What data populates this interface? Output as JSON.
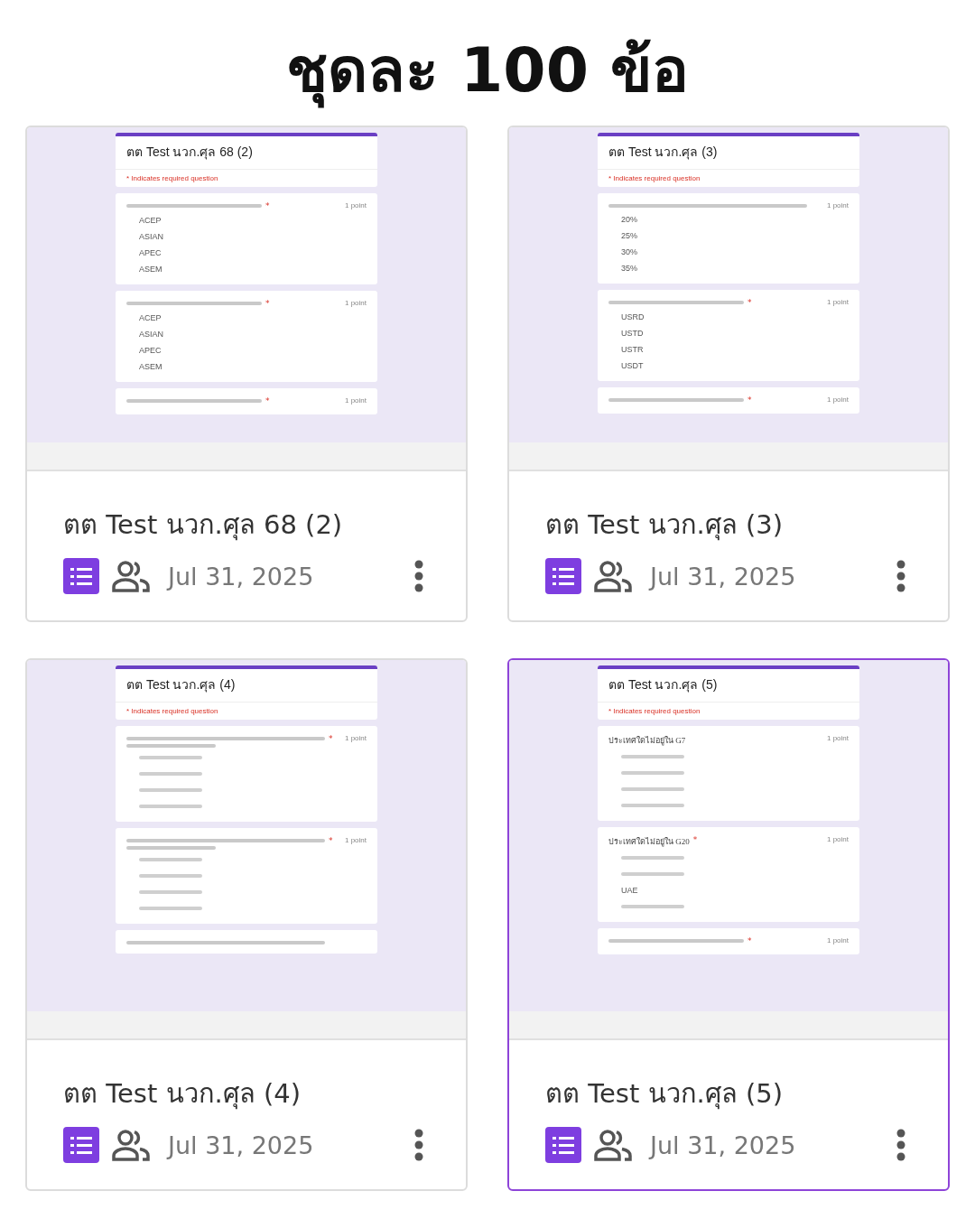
{
  "heading": "ชุดละ 100 ข้อ",
  "cards": [
    {
      "selected": false,
      "title": "ตต Test นวก.ศุล 68 (2)",
      "date": "Jul 31, 2025",
      "form": {
        "title": "ตต Test นวก.ศุล 68 (2)",
        "required_note": "* Indicates required question",
        "questions": [
          {
            "kind": "blurred",
            "required_mark": "*",
            "points": "1 point",
            "options": [
              {
                "kind": "text",
                "label": "ACEP"
              },
              {
                "kind": "text",
                "label": "ASIAN"
              },
              {
                "kind": "text",
                "label": "APEC"
              },
              {
                "kind": "text",
                "label": "ASEM"
              }
            ]
          },
          {
            "kind": "blurred",
            "required_mark": "*",
            "points": "1 point",
            "options": [
              {
                "kind": "text",
                "label": "ACEP"
              },
              {
                "kind": "text",
                "label": "ASIAN"
              },
              {
                "kind": "text",
                "label": "APEC"
              },
              {
                "kind": "text",
                "label": "ASEM"
              }
            ]
          },
          {
            "kind": "blurred",
            "required_mark": "*",
            "points": "1 point"
          }
        ]
      }
    },
    {
      "selected": false,
      "title": "ตต Test นวก.ศุล (3)",
      "date": "Jul 31, 2025",
      "form": {
        "title": "ตต Test นวก.ศุล (3)",
        "required_note": "* Indicates required question",
        "questions": [
          {
            "kind": "blurred_long",
            "points": "1 point",
            "options": [
              {
                "kind": "text",
                "label": "20%"
              },
              {
                "kind": "text",
                "label": "25%"
              },
              {
                "kind": "text",
                "label": "30%"
              },
              {
                "kind": "text",
                "label": "35%"
              }
            ]
          },
          {
            "kind": "blurred",
            "required_mark": "*",
            "points": "1 point",
            "options": [
              {
                "kind": "text",
                "label": "USRD"
              },
              {
                "kind": "text",
                "label": "USTD"
              },
              {
                "kind": "text",
                "label": "USTR"
              },
              {
                "kind": "text",
                "label": "USDT"
              }
            ]
          },
          {
            "kind": "blurred",
            "required_mark": "*",
            "points": "1 point"
          }
        ]
      }
    },
    {
      "selected": false,
      "title": "ตต Test นวก.ศุล (4)",
      "date": "Jul 31, 2025",
      "form": {
        "title": "ตต Test นวก.ศุล (4)",
        "required_note": "* Indicates required question",
        "questions": [
          {
            "kind": "blurred_two_line",
            "required_mark": "*",
            "points": "1 point",
            "options": [
              {
                "kind": "blurred"
              },
              {
                "kind": "blurred"
              },
              {
                "kind": "blurred"
              },
              {
                "kind": "blurred"
              }
            ]
          },
          {
            "kind": "blurred_two_line",
            "required_mark": "*",
            "points": "1 point",
            "options": [
              {
                "kind": "blurred"
              },
              {
                "kind": "blurred"
              },
              {
                "kind": "blurred"
              },
              {
                "kind": "blurred"
              }
            ]
          },
          {
            "kind": "blurred_long"
          }
        ]
      }
    },
    {
      "selected": true,
      "title": "ตต Test นวก.ศุล (5)",
      "date": "Jul 31, 2025",
      "form": {
        "title": "ตต Test นวก.ศุล (5)",
        "required_note": "* Indicates required question",
        "questions": [
          {
            "kind": "text",
            "text": "ประเทศใดไม่อยู่ใน G7",
            "points": "1 point",
            "options": [
              {
                "kind": "blurred"
              },
              {
                "kind": "blurred"
              },
              {
                "kind": "blurred"
              },
              {
                "kind": "blurred"
              }
            ]
          },
          {
            "kind": "text",
            "text": "ประเทศใดไม่อยู่ใน G20",
            "required_mark": "*",
            "points": "1 point",
            "options": [
              {
                "kind": "blurred"
              },
              {
                "kind": "blurred"
              },
              {
                "kind": "text",
                "label": "UAE"
              },
              {
                "kind": "blurred"
              }
            ]
          },
          {
            "kind": "blurred",
            "required_mark": "*",
            "points": "1 point"
          }
        ]
      }
    }
  ]
}
